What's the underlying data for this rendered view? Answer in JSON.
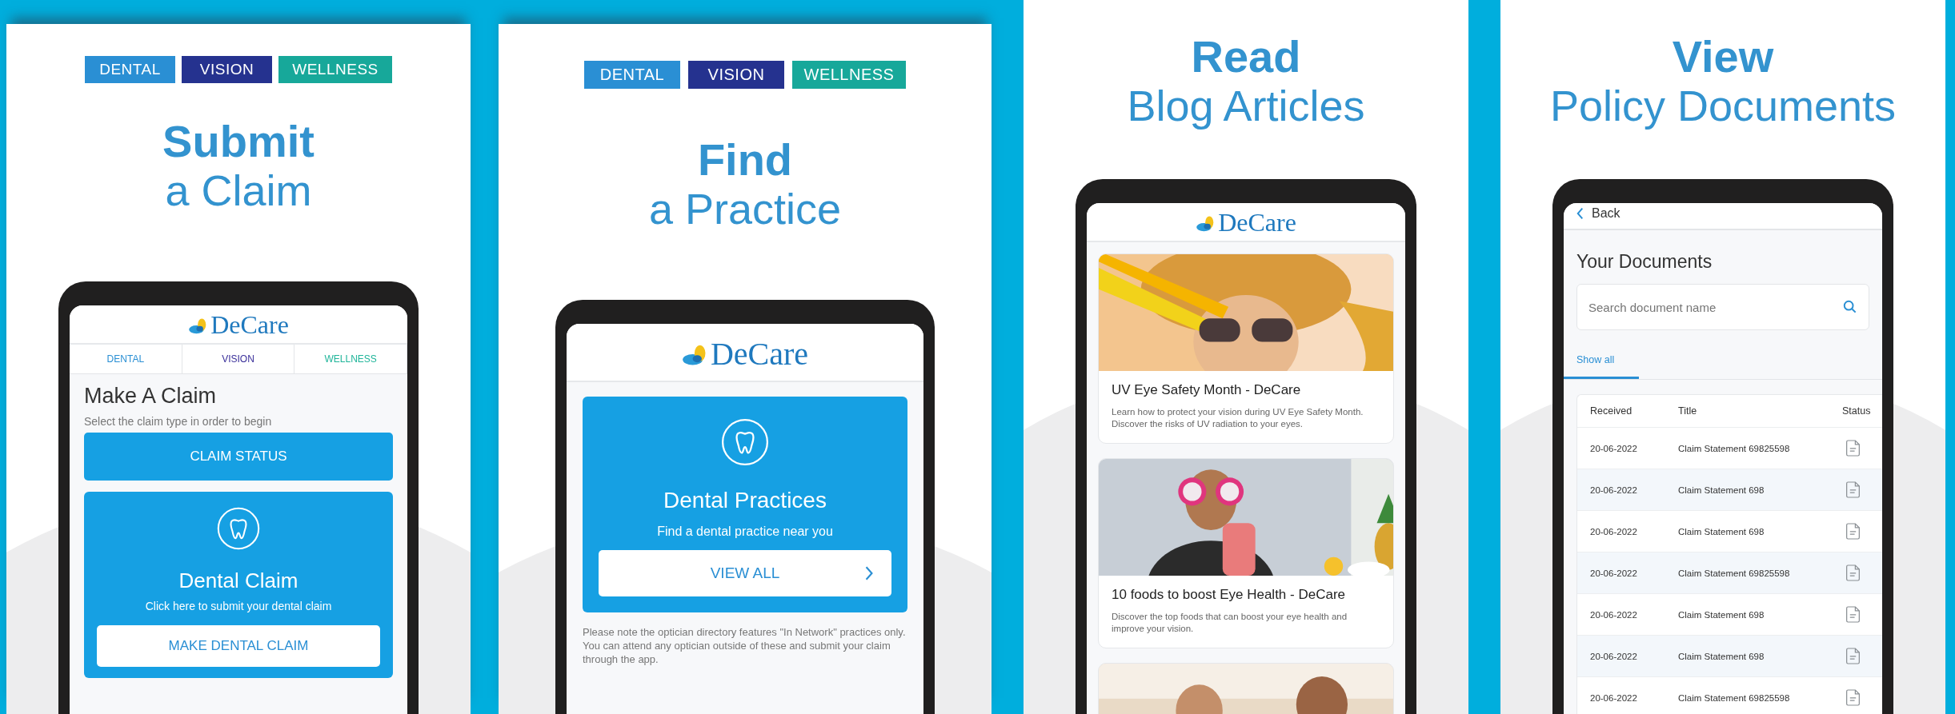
{
  "panels": [
    {
      "kind": "claim",
      "badges": [
        {
          "label": "DENTAL",
          "color": "#2a8fd4"
        },
        {
          "label": "VISION",
          "color": "#25328f"
        },
        {
          "label": "WELLNESS",
          "color": "#17a89a"
        }
      ],
      "title_bold": "Submit",
      "title_light": "a Claim",
      "phone": {
        "logo": "DeCare",
        "tabs": [
          {
            "label": "DENTAL",
            "color": "#2a8fd4"
          },
          {
            "label": "VISION",
            "color": "#3a2f9a"
          },
          {
            "label": "WELLNESS",
            "color": "#20b59a"
          }
        ],
        "heading": "Make A Claim",
        "subtitle": "Select the claim type in order to begin",
        "status_button": "CLAIM STATUS",
        "card": {
          "title": "Dental Claim",
          "text": "Click here to submit your dental claim",
          "button": "MAKE DENTAL CLAIM"
        }
      }
    },
    {
      "kind": "practice",
      "badges": [
        {
          "label": "DENTAL",
          "color": "#2a8fd4"
        },
        {
          "label": "VISION",
          "color": "#25328f"
        },
        {
          "label": "WELLNESS",
          "color": "#17a89a"
        }
      ],
      "title_bold": "Find",
      "title_light": "a Practice",
      "phone": {
        "logo": "DeCare",
        "card": {
          "title": "Dental Practices",
          "text": "Find a dental practice near you",
          "button": "VIEW ALL"
        },
        "note": "Please note the optician directory features \"In Network\" practices only. You can attend any optician outside of these and submit your claim through the app."
      }
    },
    {
      "kind": "blog",
      "title_bold": "Read",
      "title_light": "Blog Articles",
      "phone": {
        "logo": "DeCare",
        "articles": [
          {
            "kind": "picture",
            "title": "UV Eye Safety Month - DeCare",
            "text": "Learn how to protect your vision during UV Eye Safety Month. Discover the risks of UV radiation to your eyes."
          },
          {
            "kind": "picture",
            "title": "10 foods to boost Eye Health - DeCare",
            "text": "Discover the top foods that can boost your eye health and improve your vision."
          },
          {
            "kind": "picture"
          }
        ]
      }
    },
    {
      "kind": "documents",
      "title_bold": "View",
      "title_light": "Policy Documents",
      "phone": {
        "back": "Back",
        "heading": "Your Documents",
        "search": {
          "placeholder": "Search document name"
        },
        "tabs": [
          {
            "label": "Show all",
            "selected": true
          }
        ],
        "table": {
          "columns": [
            "Received",
            "Title",
            "Status"
          ],
          "rows": [
            {
              "received": "20-06-2022",
              "title": "Claim Statement 69825598"
            },
            {
              "received": "20-06-2022",
              "title": "Claim Statement 698"
            },
            {
              "received": "20-06-2022",
              "title": "Claim Statement 698"
            },
            {
              "received": "20-06-2022",
              "title": "Claim Statement 69825598"
            },
            {
              "received": "20-06-2022",
              "title": "Claim Statement 698"
            },
            {
              "received": "20-06-2022",
              "title": "Claim Statement 698"
            },
            {
              "received": "20-06-2022",
              "title": "Claim Statement 69825598"
            }
          ]
        }
      }
    }
  ]
}
